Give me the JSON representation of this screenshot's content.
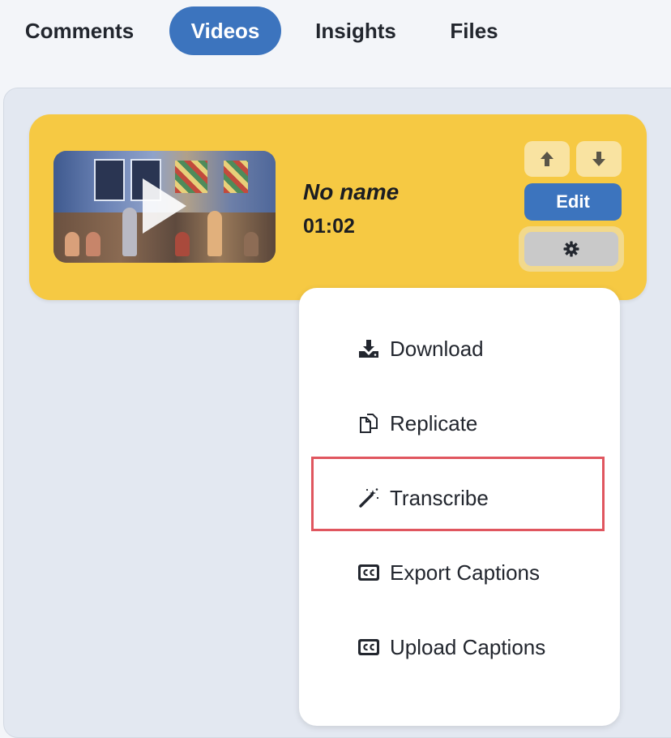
{
  "tabs": [
    {
      "label": "Comments",
      "active": false
    },
    {
      "label": "Videos",
      "active": true
    },
    {
      "label": "Insights",
      "active": false
    },
    {
      "label": "Files",
      "active": false
    }
  ],
  "video": {
    "name": "No name",
    "duration": "01:02",
    "thumbnail_icon": "play-icon",
    "edit_label": "Edit"
  },
  "menu": {
    "items": [
      {
        "label": "Download",
        "icon": "download-icon"
      },
      {
        "label": "Replicate",
        "icon": "copy-icon"
      },
      {
        "label": "Transcribe",
        "icon": "magic-wand-icon",
        "highlighted": true
      },
      {
        "label": "Export Captions",
        "icon": "closed-captions-icon"
      },
      {
        "label": "Upload Captions",
        "icon": "closed-captions-icon"
      }
    ]
  },
  "colors": {
    "accent": "#3c74be",
    "card": "#f6c943",
    "highlight_border": "#e0565f"
  }
}
